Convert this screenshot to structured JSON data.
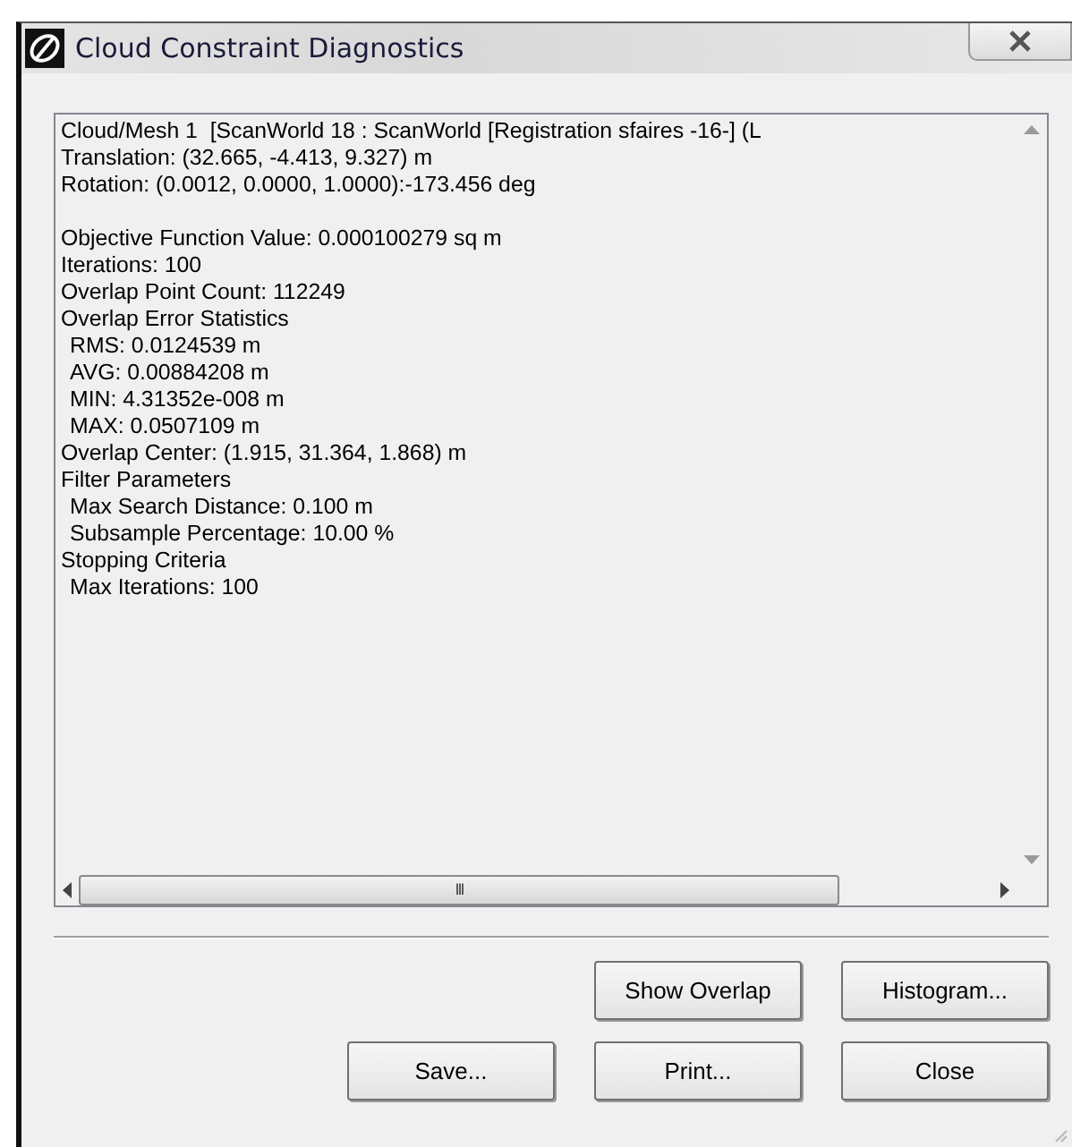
{
  "window": {
    "title": "Cloud Constraint Diagnostics"
  },
  "report": {
    "header": [
      "Cloud/Mesh 1  [ScanWorld 18 : ScanWorld [Registration sfaires -16-] (L",
      "Translation: (32.665, -4.413, 9.327) m",
      "Rotation: (0.0012, 0.0000, 1.0000):-173.456 deg"
    ],
    "details": [
      {
        "text": "Objective Function Value: 0.000100279 sq m"
      },
      {
        "text": "Iterations: 100"
      },
      {
        "text": "Overlap Point Count: 112249"
      },
      {
        "text": "Overlap Error Statistics",
        "children": [
          {
            "text": "RMS: 0.0124539 m"
          },
          {
            "text": "AVG: 0.00884208 m"
          },
          {
            "text": "MIN: 4.31352e-008 m"
          },
          {
            "text": "MAX: 0.0507109 m"
          }
        ]
      },
      {
        "text": "Overlap Center: (1.915, 31.364, 1.868) m"
      },
      {
        "text": "Filter Parameters",
        "children": [
          {
            "text": "Max Search Distance: 0.100 m"
          },
          {
            "text": "Subsample Percentage: 10.00 %"
          }
        ]
      },
      {
        "text": "Stopping Criteria",
        "children": [
          {
            "text": "Max Iterations: 100"
          }
        ]
      }
    ]
  },
  "scroll_thumb_grip": "III",
  "buttons": [
    [
      "Show Overlap",
      "Histogram..."
    ],
    [
      "Save...",
      "Print...",
      "Close"
    ]
  ]
}
